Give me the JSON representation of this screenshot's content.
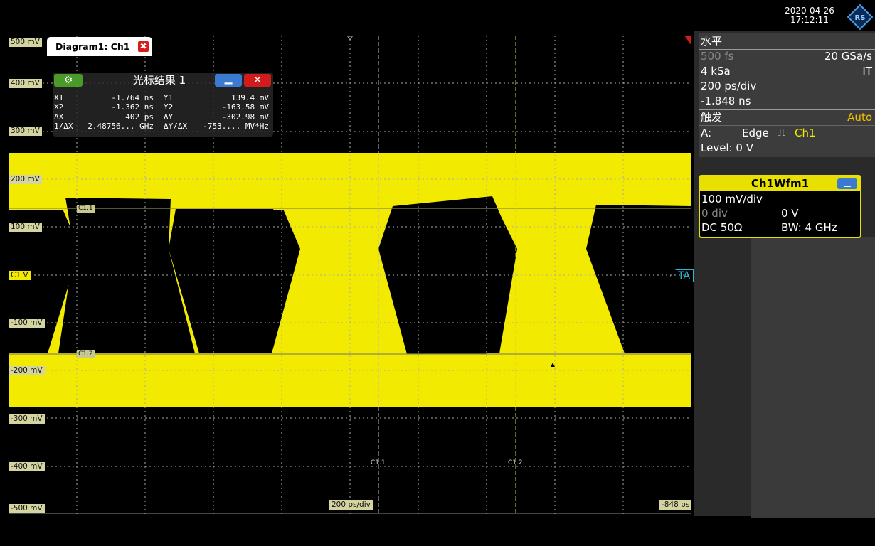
{
  "header": {
    "date": "2020-04-26",
    "time": "17:12:11"
  },
  "diagram": {
    "tab_label": "Diagram1: Ch1",
    "close_glyph": "✖"
  },
  "axis": {
    "y_labels": [
      "500 mV",
      "400 mV",
      "300 mV",
      "200 mV",
      "100 mV",
      "C1 V",
      "-100 mV",
      "-200 mV",
      "-300 mV",
      "-400 mV",
      "-500 mV"
    ],
    "timebase": "200 ps/div",
    "offset": "-848 ps",
    "trigger_tag": "TA",
    "cursor_tags": {
      "h1": "C1.1",
      "h2": "C1.2",
      "v1": "C1.1",
      "v2": "C1.2"
    }
  },
  "cursor_results": {
    "title": "光标结果 1",
    "rows": [
      {
        "k1": "X1",
        "v1": "-1.764 ns",
        "k2": "Y1",
        "v2": "139.4 mV"
      },
      {
        "k1": "X2",
        "v1": "-1.362 ns",
        "k2": "Y2",
        "v2": "-163.58 mV"
      },
      {
        "k1": "ΔX",
        "v1": "402 ps",
        "k2": "ΔY",
        "v2": "-302.98 mV"
      },
      {
        "k1": "1/ΔX",
        "v1": "2.48756... GHz",
        "k2": "ΔY/ΔX",
        "v2": "-753.... MV*Hz"
      }
    ]
  },
  "horizontal": {
    "title": "水平",
    "resolution": "500 fs",
    "sample_rate": "20 GSa/s",
    "record_length": "4 kSa",
    "mode": "IT",
    "time_scale": "200 ps/div",
    "position": "-1.848 ns",
    "trigger_title": "触发",
    "trigger_mode": "Auto",
    "trigger_a_label": "A:",
    "trigger_type": "Edge",
    "trigger_source": "Ch1",
    "trigger_level": "Level: 0 V"
  },
  "waveform": {
    "title": "Ch1Wfm1",
    "scale": "100 mV/div",
    "offset_div": "0 div",
    "offset_v": "0 V",
    "coupling": "DC 50Ω",
    "bandwidth": "BW: 4 GHz"
  },
  "colors": {
    "trace": "#f2ea00",
    "panel_accent": "#e8e000",
    "auto": "#f0c000"
  }
}
